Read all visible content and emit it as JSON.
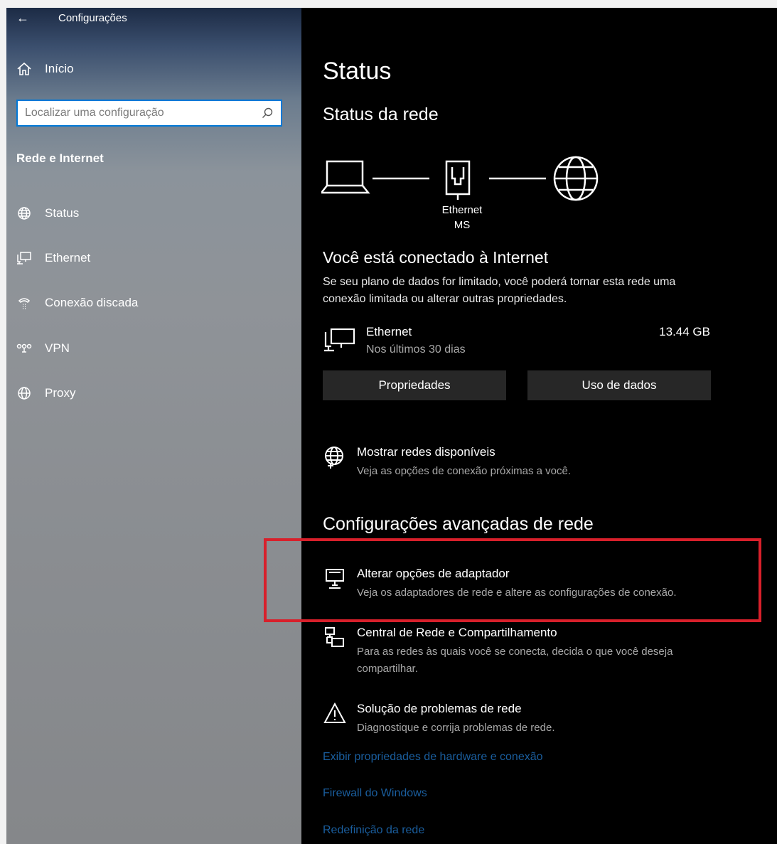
{
  "window": {
    "title": "Configurações"
  },
  "sidebar": {
    "home_label": "Início",
    "search_placeholder": "Localizar uma configuração",
    "section_label": "Rede e Internet",
    "items": [
      {
        "label": "Status",
        "icon": "globe-icon"
      },
      {
        "label": "Ethernet",
        "icon": "ethernet-icon"
      },
      {
        "label": "Conexão discada",
        "icon": "dialup-icon"
      },
      {
        "label": "VPN",
        "icon": "vpn-icon"
      },
      {
        "label": "Proxy",
        "icon": "globe-icon"
      }
    ]
  },
  "main": {
    "page_title": "Status",
    "network_status_title": "Status da rede",
    "diagram": {
      "adapter_line1": "Ethernet",
      "adapter_line2": "MS"
    },
    "connected_title": "Você está conectado à Internet",
    "connected_desc": "Se seu plano de dados for limitado, você poderá tornar esta rede uma conexão limitada ou alterar outras propriedades.",
    "ethernet": {
      "name": "Ethernet",
      "period": "Nos últimos 30 dias",
      "usage": "13.44 GB"
    },
    "buttons": {
      "properties": "Propriedades",
      "data_usage": "Uso de dados"
    },
    "show_networks": {
      "title": "Mostrar redes disponíveis",
      "desc": "Veja as opções de conexão próximas a você."
    },
    "advanced_title": "Configurações avançadas de rede",
    "adapter_options": {
      "title": "Alterar opções de adaptador",
      "desc": "Veja os adaptadores de rede e altere as configurações de conexão."
    },
    "sharing_center": {
      "title": "Central de Rede e Compartilhamento",
      "desc": "Para as redes às quais você se conecta, decida o que você deseja compartilhar."
    },
    "troubleshoot": {
      "title": "Solução de problemas de rede",
      "desc": "Diagnostique e corrija problemas de rede."
    },
    "links": {
      "hardware_props": "Exibir propriedades de hardware e conexão",
      "firewall": "Firewall do Windows",
      "network_reset": "Redefinição da rede"
    }
  },
  "colors": {
    "accent": "#0078d7",
    "highlight": "#d8202b",
    "link": "#1a5e9e"
  }
}
